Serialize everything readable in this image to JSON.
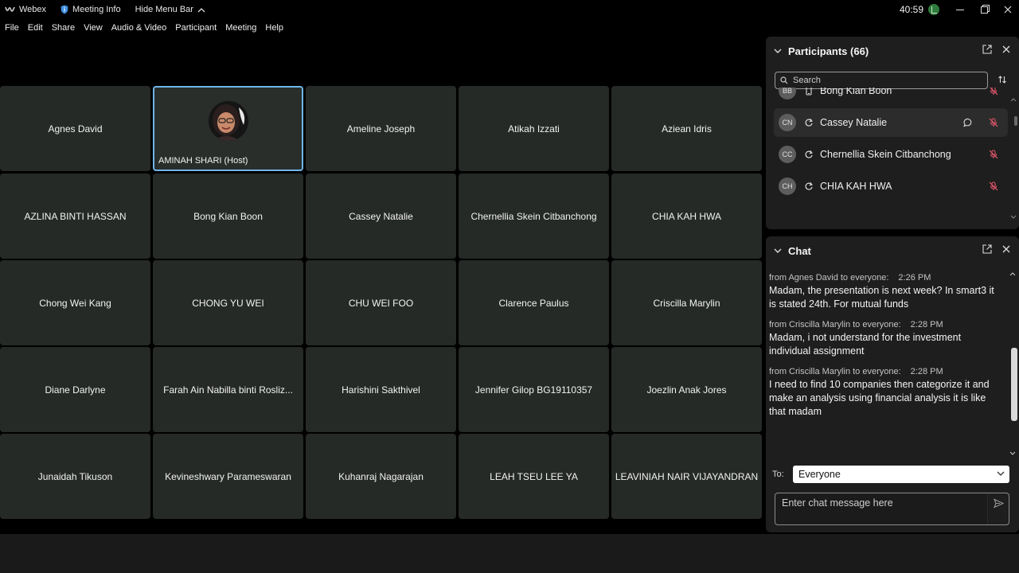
{
  "titlebar": {
    "app_name": "Webex",
    "meeting_info": "Meeting Info",
    "hide_menu": "Hide Menu Bar",
    "timer": "40:59",
    "colors": {
      "timer_badge": "#2f7a3c"
    }
  },
  "menu": [
    "File",
    "Edit",
    "Share",
    "View",
    "Audio & Video",
    "Participant",
    "Meeting",
    "Help"
  ],
  "grid": {
    "tiles": [
      "Agnes David",
      "AMINAH SHARI (Host)",
      "Ameline Joseph",
      "Atikah Izzati",
      "Aziean Idris",
      "AZLINA BINTI HASSAN",
      "Bong Kian Boon",
      "Cassey Natalie",
      "Chernellia Skein Citbanchong",
      "CHIA KAH HWA",
      "Chong Wei Kang",
      "CHONG YU WEI",
      "CHU WEI FOO",
      "Clarence Paulus",
      "Criscilla Marylin",
      "Diane Darlyne",
      "Farah Ain Nabilla binti Rosliz...",
      "Harishini Sakthivel",
      "Jennifer Gilop BG19110357",
      "Joezlin Anak Jores",
      "Junaidah Tikuson",
      "Kevineshwary Parameswaran",
      "Kuhanraj Nagarajan",
      "LEAH TSEU LEE YA",
      "LEAVINIAH NAIR VIJAYANDRAN"
    ],
    "active_speaker_color": "#6fb6e8"
  },
  "participants": {
    "title": "Participants (66)",
    "search_placeholder": "Search",
    "list": [
      {
        "initials": "BB",
        "name": "Bong Kian Boon",
        "device": "phone-icon"
      },
      {
        "initials": "CN",
        "name": "Cassey Natalie",
        "device": "sync-icon"
      },
      {
        "initials": "CC",
        "name": "Chernellia Skein Citbanchong",
        "device": "sync-icon"
      },
      {
        "initials": "CH",
        "name": "CHIA KAH HWA",
        "device": "sync-icon"
      }
    ],
    "mute_color": "#e0566b"
  },
  "chat": {
    "title": "Chat",
    "messages": [
      {
        "meta": "from Agnes David to everyone:",
        "time": "2:26 PM",
        "text": "Madam, the presentation is next week? In smart3 it is stated 24th. For mutual funds"
      },
      {
        "meta": "from Criscilla Marylin to everyone:",
        "time": "2:28 PM",
        "text": "Madam, i not understand for the investment individual assignment"
      },
      {
        "meta": "from Criscilla Marylin to everyone:",
        "time": "2:28 PM",
        "text": "I need to find 10 companies then categorize it and make an analysis using financial analysis it is like that madam"
      }
    ],
    "to_label": "To:",
    "to_value": "Everyone",
    "input_placeholder": "Enter chat message here"
  }
}
